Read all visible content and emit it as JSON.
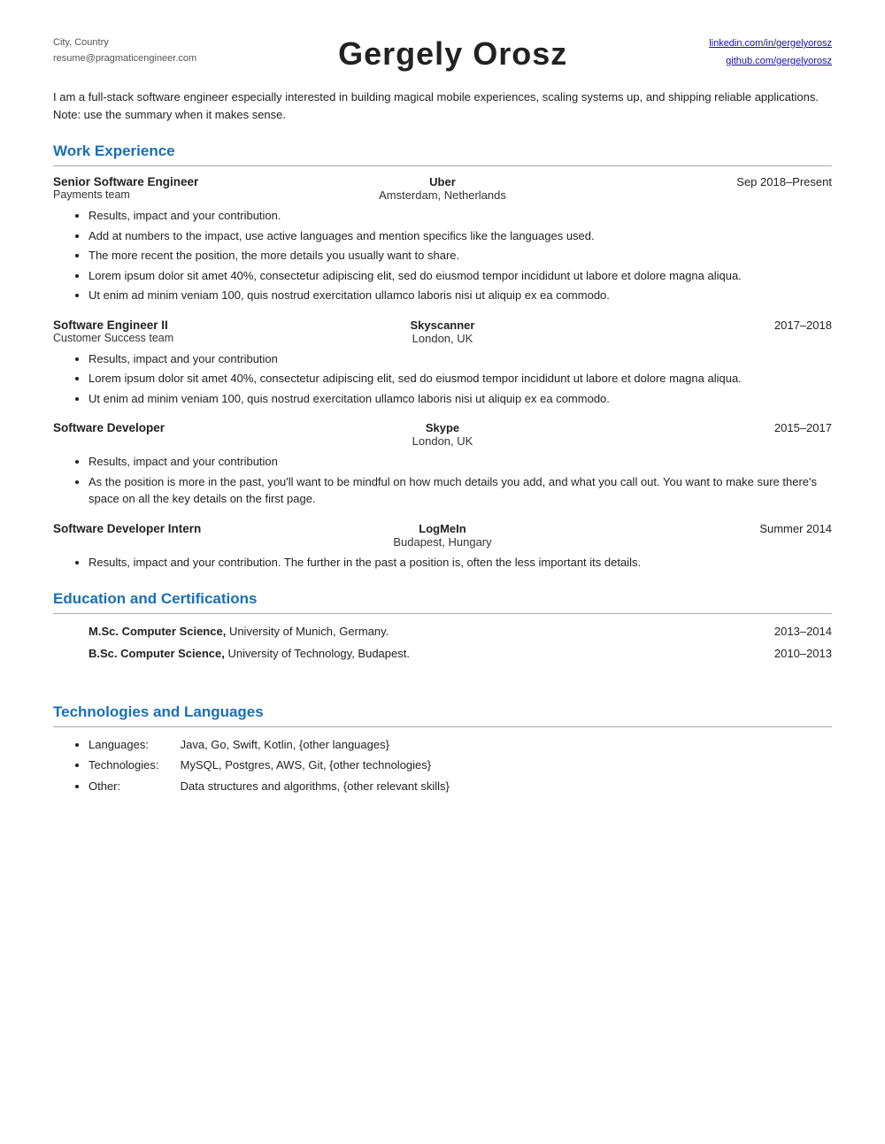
{
  "header": {
    "left": {
      "city": "City, Country",
      "email": "resume@pragmaticengineer.com"
    },
    "name": "Gergely Orosz",
    "right": {
      "linkedin": "linkedin.com/in/gergelyorosz",
      "github": "github.com/gergelyorosz"
    }
  },
  "summary": "I am a full-stack software engineer especially interested in building magical mobile experiences, scaling systems up, and shipping reliable applications. Note: use the summary when it makes sense.",
  "work_experience": {
    "section_title": "Work Experience",
    "jobs": [
      {
        "title": "Senior Software Engineer",
        "team": "Payments team",
        "company": "Uber",
        "location": "Amsterdam, Netherlands",
        "dates": "Sep 2018–Present",
        "bullets": [
          "Results, impact and your contribution.",
          "Add at numbers to the impact, use active languages and mention specifics like the languages used.",
          "The more recent the position, the more details you usually want to share.",
          "Lorem ipsum dolor sit amet 40%, consectetur adipiscing elit, sed do eiusmod tempor incididunt ut labore et dolore magna aliqua.",
          "Ut enim ad minim veniam 100, quis nostrud exercitation ullamco laboris nisi ut aliquip ex ea commodo."
        ]
      },
      {
        "title": "Software Engineer II",
        "team": "Customer Success team",
        "company": "Skyscanner",
        "location": "London, UK",
        "dates": "2017–2018",
        "bullets": [
          "Results, impact and your contribution",
          "Lorem ipsum dolor sit amet 40%, consectetur adipiscing elit, sed do eiusmod tempor incididunt ut labore et dolore magna aliqua.",
          "Ut enim ad minim veniam 100, quis nostrud exercitation ullamco laboris nisi ut aliquip ex ea commodo."
        ]
      },
      {
        "title": "Software Developer",
        "team": "",
        "company": "Skype",
        "location": "London, UK",
        "dates": "2015–2017",
        "bullets": [
          "Results, impact and your contribution",
          "As the position is more in the past, you'll want to be mindful on how much details you add, and what you call out. You want to make sure there's space on all the key details on the first page."
        ]
      },
      {
        "title": "Software Developer Intern",
        "team": "",
        "company": "LogMeIn",
        "location": "Budapest, Hungary",
        "dates": "Summer 2014",
        "bullets": [
          "Results, impact and your contribution. The further in the past a position is, often the less important its details."
        ]
      }
    ]
  },
  "education": {
    "section_title": "Education and Certifications",
    "items": [
      {
        "text_bold": "M.Sc. Computer Science,",
        "text": " University of Munich, Germany.",
        "year": "2013–2014"
      },
      {
        "text_bold": "B.Sc. Computer Science,",
        "text": " University of Technology, Budapest.",
        "year": "2010–2013"
      },
      {
        "text_bold": "",
        "text": "",
        "year": ""
      }
    ]
  },
  "technologies": {
    "section_title": "Technologies and Languages",
    "items": [
      {
        "label": "Languages:",
        "value": "Java, Go, Swift, Kotlin, {other languages}"
      },
      {
        "label": "Technologies:",
        "value": "MySQL, Postgres, AWS, Git, {other technologies}"
      },
      {
        "label": "Other:",
        "value": "Data structures and algorithms, {other relevant skills}"
      }
    ]
  }
}
